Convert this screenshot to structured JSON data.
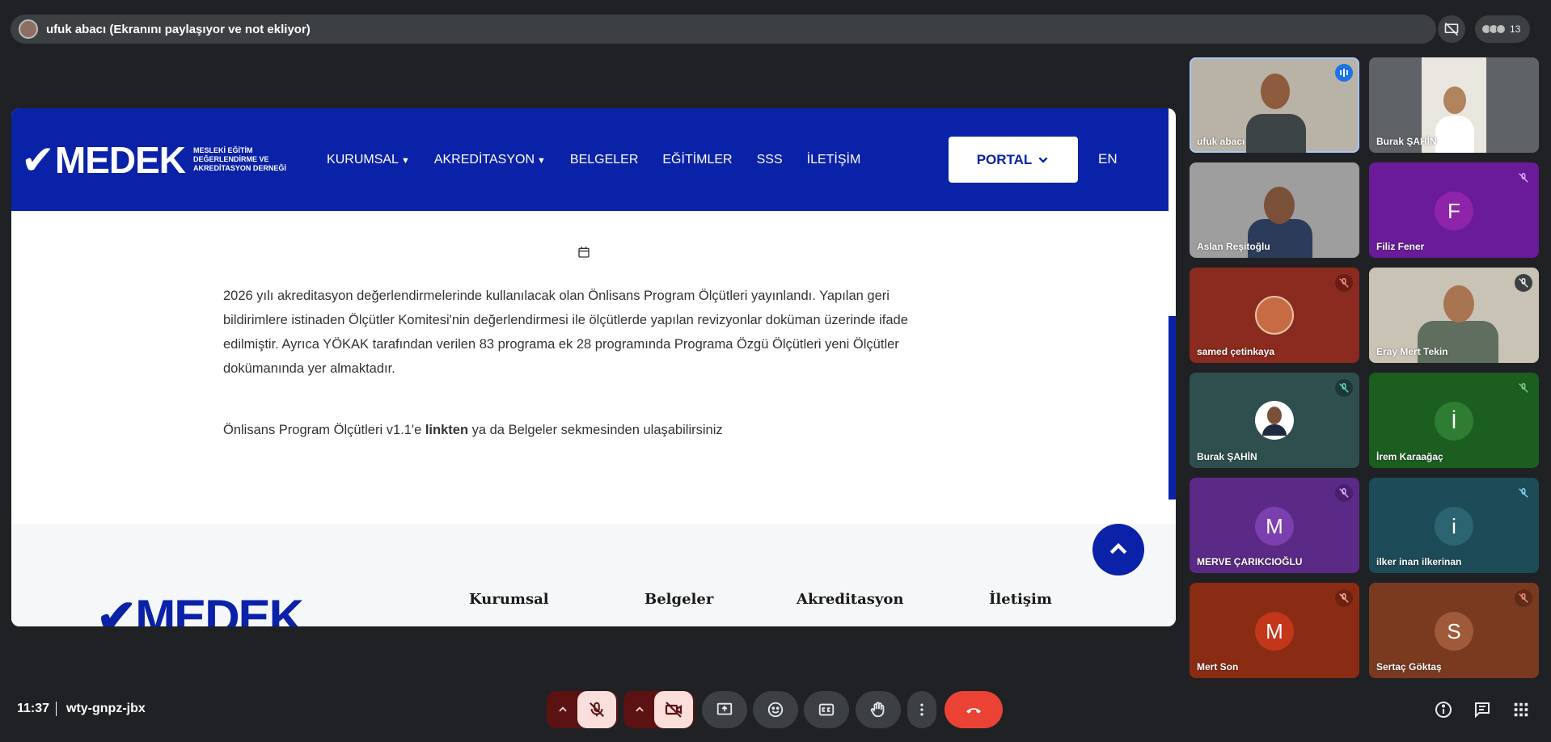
{
  "presenter_bar": {
    "title": "ufuk abacı (Ekranını paylaşıyor ve not ekliyor)",
    "participant_count": "13"
  },
  "shared_screen": {
    "nav": {
      "logo_text": "MEDEK",
      "logo_subtitle": "MESLEKİ EĞİTİM DEĞERLENDİRME VE AKREDİTASYON DERNEĞİ",
      "menu": [
        "KURUMSAL",
        "AKREDİTASYON",
        "BELGELER",
        "EĞİTİMLER",
        "SSS",
        "İLETİŞİM"
      ],
      "portal": "PORTAL",
      "lang": "EN"
    },
    "article": {
      "paragraph1": "2026 yılı akreditasyon değerlendirmelerinde kullanılacak olan Önlisans Program Ölçütleri yayınlandı. Yapılan geri bildirimlere istinaden Ölçütler Komitesi'nin değerlendirmesi ile ölçütlerde yapılan revizyonlar doküman üzerinde ifade edilmiştir. Ayrıca YÖKAK tarafından verilen 83 programa ek 28 programında Programa Özgü Ölçütleri yeni Ölçütler dokümanında yer almaktadır.",
      "p2_before": "Önlisans Program Ölçütleri v1.1'e ",
      "p2_link": "linkten",
      "p2_after": " ya da Belgeler sekmesinden ulaşabilirsiniz"
    },
    "footer": {
      "logo": "MEDEK",
      "columns": [
        "Kurumsal",
        "Belgeler",
        "Akreditasyon",
        "İletişim"
      ]
    }
  },
  "participants": [
    {
      "name": "ufuk abacı",
      "type": "video",
      "bg": "#b9b2a6",
      "speaking": true
    },
    {
      "name": "Burak ŞAHİN",
      "type": "video",
      "bg": "#5f6368"
    },
    {
      "name": "Aslan Reşitoğlu",
      "type": "video",
      "bg": "#9e9e9e"
    },
    {
      "name": "Filiz Fener",
      "type": "initial",
      "initial": "F",
      "bg": "#6a1b9a",
      "circle": "#8e24aa",
      "muted": true
    },
    {
      "name": "samed çetinkaya",
      "type": "photo",
      "bg": "#8b2a1f",
      "muted": true
    },
    {
      "name": "Eray Mert Tekin",
      "type": "video",
      "bg": "#c9c3b5",
      "muted": true
    },
    {
      "name": "Burak ŞAHİN",
      "type": "photo",
      "bg": "#2f4f4f",
      "muted": true
    },
    {
      "name": "İrem Karaağaç",
      "type": "initial",
      "initial": "İ",
      "bg": "#1b5e20",
      "circle": "#2e7d32",
      "muted": true
    },
    {
      "name": "MERVE ÇARIKCIOĞLU",
      "type": "initial",
      "initial": "M",
      "bg": "#5b2a86",
      "circle": "#7b3fb0",
      "muted": true
    },
    {
      "name": "ilker inan ilkerinan",
      "type": "initial",
      "initial": "i",
      "bg": "#1d4b57",
      "circle": "#2d6472",
      "muted": true
    },
    {
      "name": "Mert Son",
      "type": "initial",
      "initial": "M",
      "bg": "#8a2c13",
      "circle": "#c2361a",
      "muted": true
    },
    {
      "name": "Sertaç Göktaş",
      "type": "initial",
      "initial": "S",
      "bg": "#7a3a20",
      "circle": "#9e5a3a",
      "muted": true
    }
  ],
  "bottom_bar": {
    "time": "11:37",
    "meeting_code": "wty-gnpz-jbx"
  },
  "colors": {
    "brand_blue": "#0a22a8",
    "end_call": "#ea4335",
    "muted_control": "#f9dedc"
  }
}
